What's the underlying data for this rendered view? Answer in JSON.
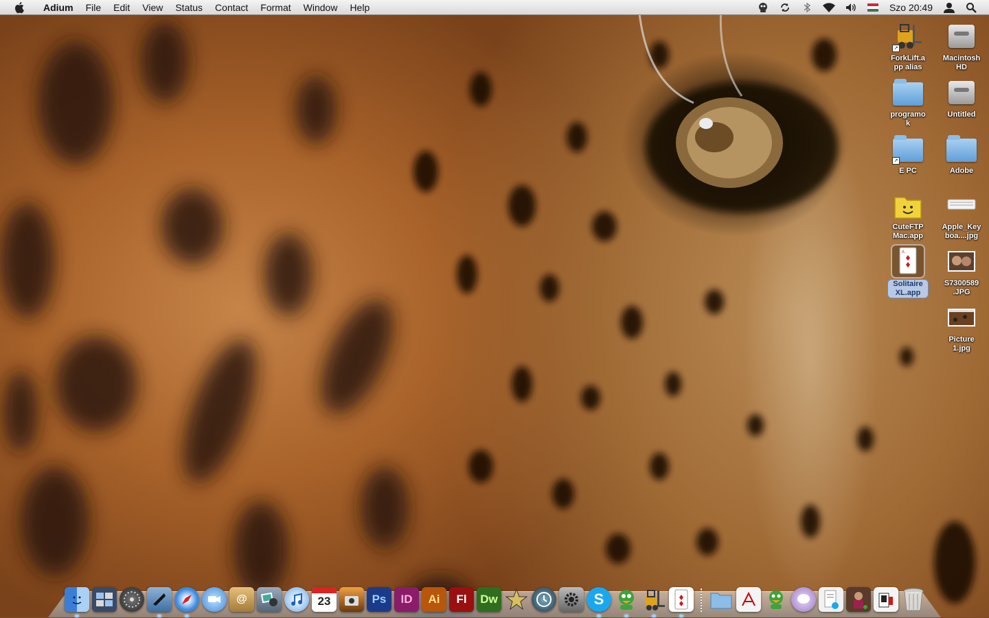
{
  "menubar": {
    "app_name": "Adium",
    "items": [
      "File",
      "Edit",
      "View",
      "Status",
      "Contact",
      "Format",
      "Window",
      "Help"
    ],
    "clock": "Szo 20:49",
    "status_icons": [
      "adium-duck-icon",
      "sync-icon",
      "bluetooth-icon",
      "wifi-icon",
      "volume-icon",
      "input-flag-icon",
      "user-icon",
      "spotlight-icon"
    ]
  },
  "desktop": {
    "icons": [
      {
        "label": "ForkLift.a\npp alias",
        "icon": "forklift-app-icon"
      },
      {
        "label": "Macintosh\nHD",
        "icon": "hard-drive-icon"
      },
      {
        "label": "programo\nk",
        "icon": "folder-icon"
      },
      {
        "label": "Untitled",
        "icon": "hard-drive-icon"
      },
      {
        "label": "E PC",
        "icon": "folder-alias-icon"
      },
      {
        "label": "Adobe",
        "icon": "folder-icon"
      },
      {
        "label": "CuteFTP\nMac.app",
        "icon": "cuteftp-app-icon"
      },
      {
        "label": "Apple_Key\nboa....jpg",
        "icon": "image-file-icon"
      },
      {
        "label": "Solitaire\nXL.app",
        "icon": "solitaire-app-icon",
        "selected": true
      },
      {
        "label": "S7300589\n.JPG",
        "icon": "photo-file-icon"
      },
      {
        "label": "Picture\n1.jpg",
        "icon": "screenshot-file-icon"
      }
    ]
  },
  "dock": {
    "apps": [
      "finder-icon",
      "dashboard-icon",
      "system-preferences-dial-icon",
      "mail-stamp-icon",
      "safari-icon",
      "ichat-icon",
      "address-book-icon",
      "iphoto-icon",
      "itunes-icon",
      "ical-icon",
      "image-capture-icon",
      "photoshop-icon",
      "indesign-icon",
      "illustrator-icon",
      "flash-icon",
      "dreamweaver-icon",
      "imovie-icon",
      "time-machine-icon",
      "system-preferences-icon",
      "skype-icon",
      "adium-icon",
      "forklift-icon",
      "solitaire-icon"
    ],
    "ical_day": "23",
    "app_letters": {
      "photoshop": "Ps",
      "indesign": "ID",
      "illustrator": "Ai",
      "flash": "Fl",
      "dreamweaver": "Dw"
    },
    "right_items": [
      "downloads-stack-icon",
      "pdf-document-icon",
      "adium-document-icon",
      "ichat-bubble-icon",
      "document-stack-icon",
      "photo-stack-icon",
      "card-stack-icon",
      "trash-icon"
    ],
    "colors": {
      "photoshop": "#1c3a8a",
      "indesign": "#8a1c6a",
      "illustrator": "#b8560b",
      "flash": "#9a1010",
      "dreamweaver": "#2f6d1f",
      "skype": "#19a8f0"
    }
  }
}
